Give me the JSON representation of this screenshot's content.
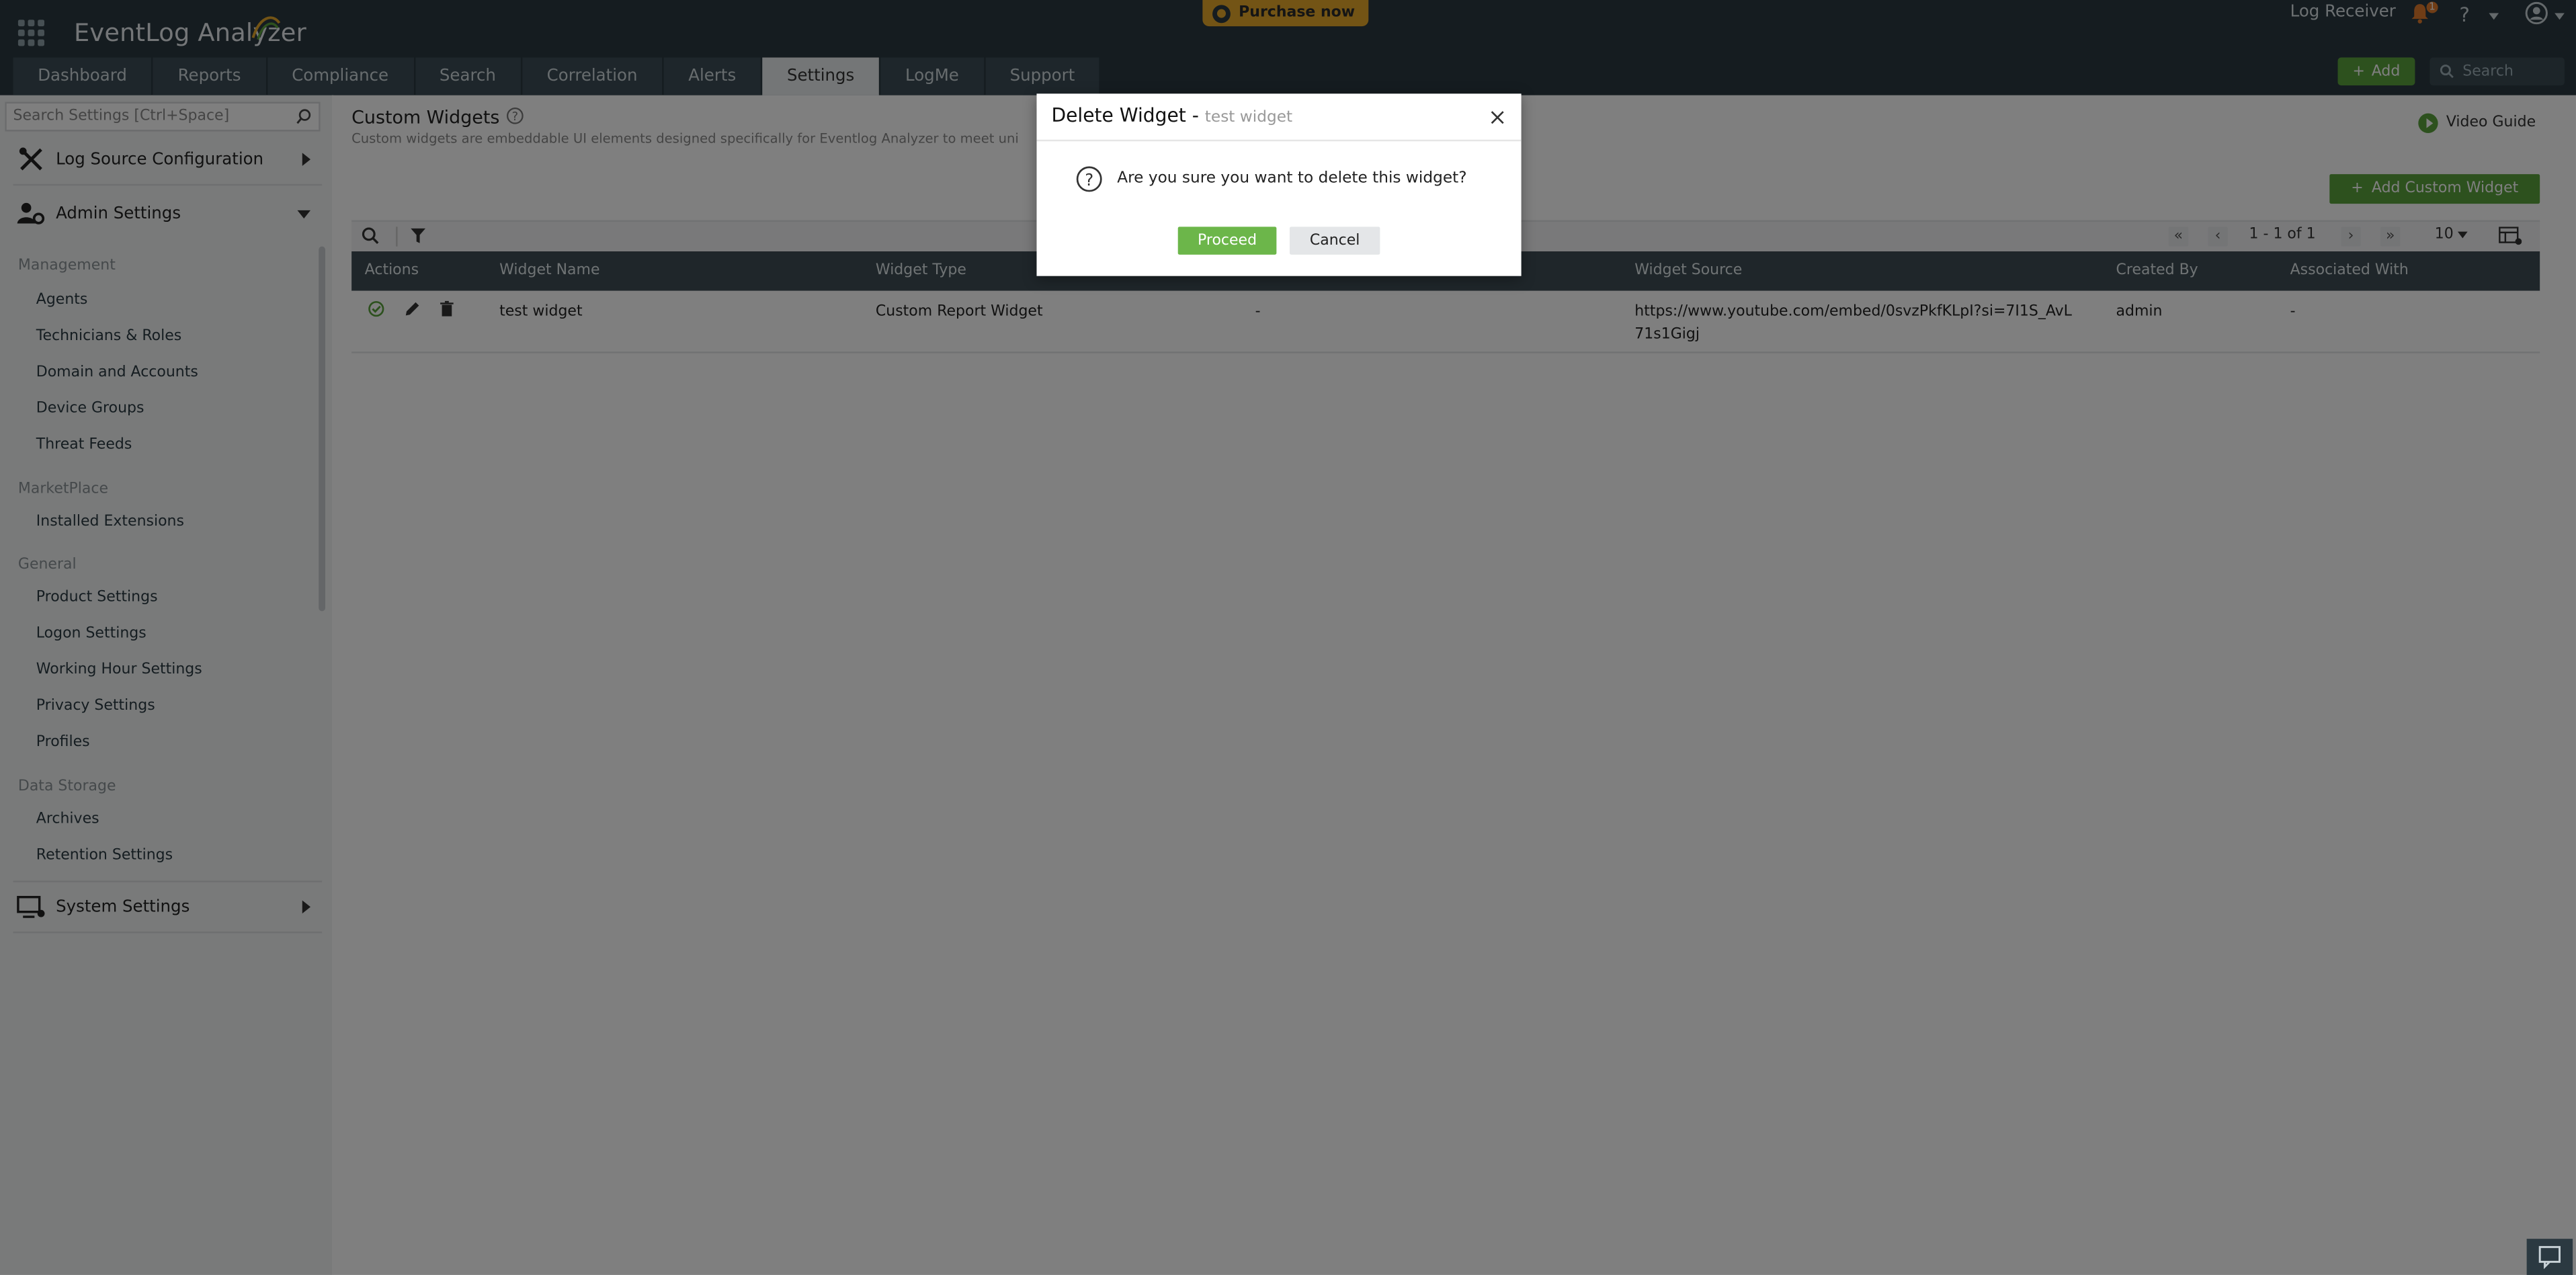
{
  "app": {
    "logo": "EventLog Analyzer",
    "purchase_label": "Purchase now",
    "log_receiver": "Log Receiver",
    "notification_count": "1",
    "help_label": "?",
    "add_label": "Add",
    "search_placeholder": "Search"
  },
  "tabs": [
    {
      "label": "Dashboard"
    },
    {
      "label": "Reports"
    },
    {
      "label": "Compliance"
    },
    {
      "label": "Search"
    },
    {
      "label": "Correlation"
    },
    {
      "label": "Alerts"
    },
    {
      "label": "Settings",
      "active": true
    },
    {
      "label": "LogMe"
    },
    {
      "label": "Support"
    }
  ],
  "sidebar": {
    "search_placeholder": "Search Settings [Ctrl+Space]",
    "sections": {
      "log_source": "Log Source Configuration",
      "admin": "Admin Settings",
      "system": "System Settings"
    },
    "groups": {
      "management": "Management",
      "marketplace": "MarketPlace",
      "general": "General",
      "data_storage": "Data Storage"
    },
    "items": [
      "Agents",
      "Technicians & Roles",
      "Domain and Accounts",
      "Device Groups",
      "Threat Feeds",
      "Installed Extensions",
      "Product Settings",
      "Logon Settings",
      "Working Hour Settings",
      "Privacy Settings",
      "Profiles",
      "Archives",
      "Retention Settings"
    ]
  },
  "main": {
    "title": "Custom Widgets",
    "description": "Custom widgets are embeddable UI elements designed specifically for Eventlog Analyzer to meet uni",
    "video_guide": "Video Guide",
    "add_custom_widget": "Add Custom Widget",
    "pagination": {
      "range": "1 - 1 of 1",
      "page_size": "10"
    },
    "columns": [
      "Actions",
      "Widget Name",
      "Widget Type",
      "",
      "Widget Source",
      "Created By",
      "Associated With"
    ],
    "rows": [
      {
        "name": "test widget",
        "type": "Custom Report Widget",
        "col4": "-",
        "source_line1": "https://www.youtube.com/embed/0svzPkfKLpI?si=7I1S_AvL",
        "source_line2": "71s1Gigj",
        "created_by": "admin",
        "associated_with": "-"
      }
    ]
  },
  "dialog": {
    "title": "Delete Widget -",
    "subtitle": "test widget",
    "message": "Are you sure you want to delete this widget?",
    "proceed": "Proceed",
    "cancel": "Cancel"
  },
  "colors": {
    "header_bg": "#2b3941",
    "accent_green": "#5aa23c",
    "purchase_yellow": "#e6a82a",
    "table_head": "#3e4d55"
  }
}
